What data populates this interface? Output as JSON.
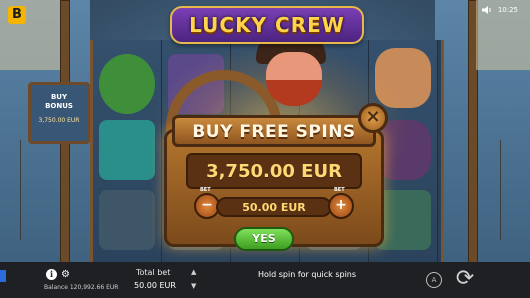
{
  "top_bar": {
    "brand_logo_letter": "B",
    "game_logo": "LUCKY CREW",
    "time": "10:25"
  },
  "side_board": {
    "title_line1": "BUY",
    "title_line2": "BONUS",
    "price": "3,750.00 EUR"
  },
  "modal": {
    "title": "BUY FREE SPINS",
    "close_symbol": "×",
    "price": "3,750.00 EUR",
    "bet_label_left": "BET",
    "bet_label_right": "BET",
    "bet_value": "50.00 EUR",
    "minus_symbol": "−",
    "plus_symbol": "+",
    "confirm_label": "YES"
  },
  "bottom_bar": {
    "info_symbol": "i",
    "gear_symbol": "⚙",
    "balance": "Balance 120,992.66 EUR",
    "total_bet_label": "Total bet",
    "total_bet_value": "50.00 EUR",
    "up_arrow": "▲",
    "down_arrow": "▼",
    "hint": "Hold spin for quick spins",
    "auto_label": "A",
    "spin_symbol": "⟳"
  },
  "colors": {
    "accent_gold": "#ffd774",
    "yes_green": "#3e9e22",
    "frame_brown": "#7c4a1b"
  }
}
